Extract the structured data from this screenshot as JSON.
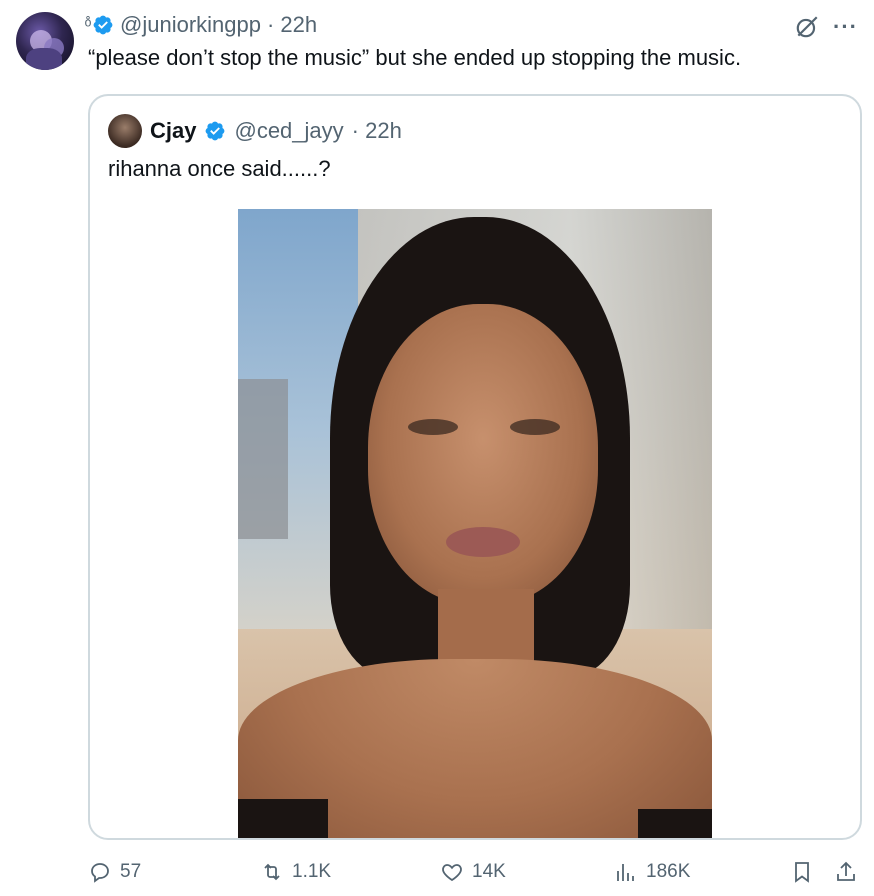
{
  "tweet": {
    "emoji_prefix": "ͦ̊",
    "handle": "@juniorkingpp",
    "time": "· 22h",
    "text": "“please don’t stop the music” but she ended up stopping the music."
  },
  "quote": {
    "name": "Cjay",
    "handle": "@ced_jayy",
    "time": "· 22h",
    "text": "rihanna once said......?"
  },
  "actions": {
    "replies": "57",
    "reposts": "1.1K",
    "likes": "14K",
    "views": "186K"
  },
  "icons": [
    "verified-badge-icon",
    "grok-icon",
    "more-icon",
    "reply-icon",
    "repost-icon",
    "like-icon",
    "views-icon",
    "bookmark-icon",
    "share-icon"
  ],
  "colors": {
    "verified": "#1d9bf0",
    "text": "#0f1419",
    "muted": "#536471",
    "border": "#cfd9de"
  }
}
